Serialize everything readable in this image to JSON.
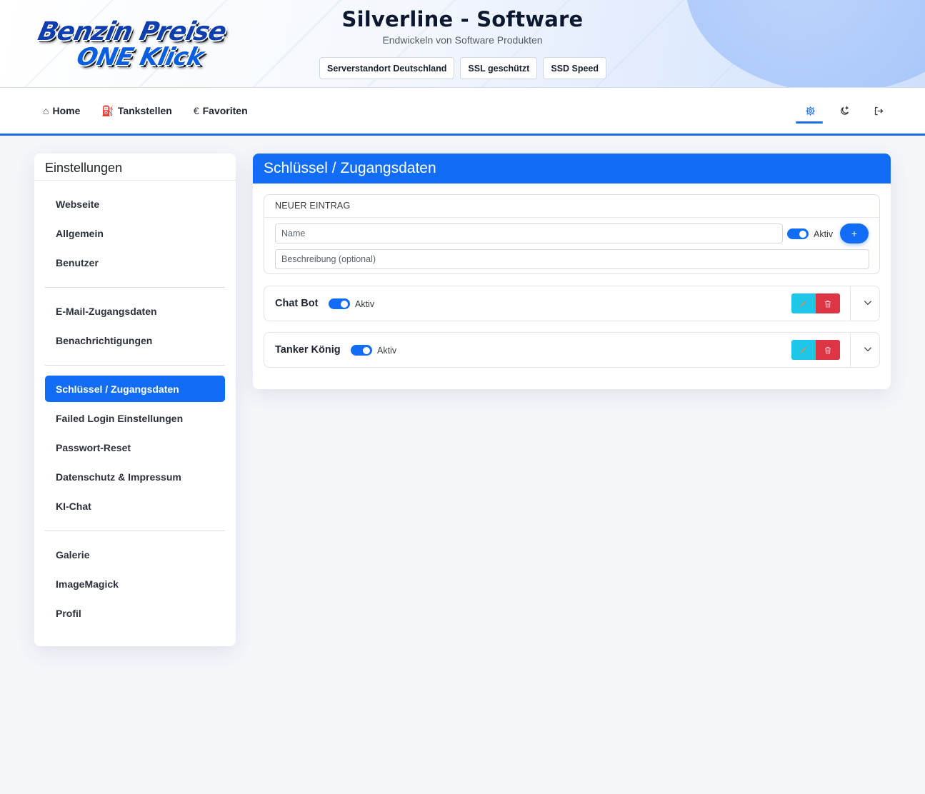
{
  "header": {
    "logo_line1": "Benzin Preise",
    "logo_line2": "ONE Klick",
    "title": "Silverline - Software",
    "subtitle": "Endwickeln von Software Produkten",
    "badges": [
      "Serverstandort Deutschland",
      "SSL geschützt",
      "SSD Speed"
    ]
  },
  "nav": {
    "home": "Home",
    "tankstellen": "Tankstellen",
    "favoriten": "Favoriten",
    "home_icon": "⌂",
    "tankstellen_icon": "⛽",
    "favoriten_icon": "€",
    "right_icons": [
      "gear-icon",
      "moon-icon",
      "logout-icon"
    ]
  },
  "sidebar": {
    "title": "Einstellungen",
    "groups": [
      [
        "Webseite",
        "Allgemein",
        "Benutzer"
      ],
      [
        "E-Mail-Zugangsdaten",
        "Benachrichtigungen"
      ],
      [
        "Schlüssel / Zugangsdaten",
        "Failed Login Einstellungen",
        "Passwort-Reset",
        "Datenschutz & Impressum",
        "KI-Chat"
      ],
      [
        "Galerie",
        "ImageMagick",
        "Profil"
      ]
    ],
    "active": "Schlüssel / Zugangsdaten"
  },
  "main": {
    "title": "Schlüssel / Zugangsdaten",
    "new_entry": {
      "heading": "NEUER EINTRAG",
      "name_placeholder": "Name",
      "description_placeholder": "Beschreibung (optional)",
      "active_label": "Aktiv",
      "active": true,
      "add_label": "+"
    },
    "entries": [
      {
        "name": "Chat Bot",
        "active_label": "Aktiv",
        "active": true
      },
      {
        "name": "Tanker König",
        "active_label": "Aktiv",
        "active": true
      }
    ]
  },
  "colors": {
    "primary": "#116df6",
    "edit": "#1ec6ea",
    "delete": "#dc3545"
  }
}
